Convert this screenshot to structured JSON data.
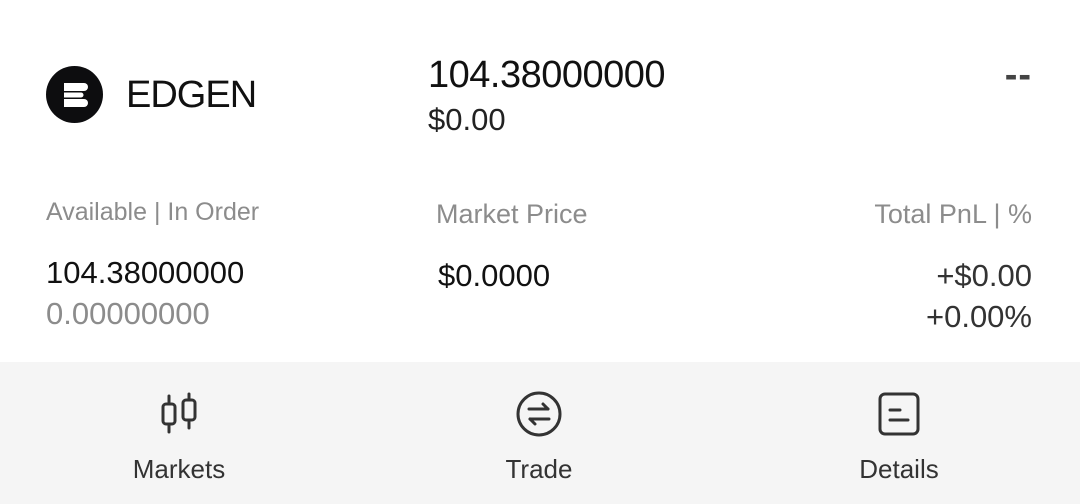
{
  "asset": {
    "name": "EDGEN",
    "logo_icon": "edgen-logo-icon",
    "total_amount": "104.38000000",
    "total_value": "$0.00",
    "pnl_placeholder": "--"
  },
  "details": {
    "available_label": "Available | In Order",
    "available_value": "104.38000000",
    "in_order_value": "0.00000000",
    "market_price_label": "Market Price",
    "market_price_value": "$0.0000",
    "total_pnl_label": "Total PnL | %",
    "total_pnl_amount": "+$0.00",
    "total_pnl_percent": "+0.00%"
  },
  "actions": [
    {
      "label": "Markets",
      "icon": "candlestick-chart-icon"
    },
    {
      "label": "Trade",
      "icon": "swap-arrows-icon"
    },
    {
      "label": "Details",
      "icon": "document-details-icon"
    }
  ],
  "colors": {
    "text_primary": "#111111",
    "text_secondary": "#8c8c8c",
    "bottom_bar": "#f5f5f5",
    "logo_bg": "#0d0d0f"
  }
}
